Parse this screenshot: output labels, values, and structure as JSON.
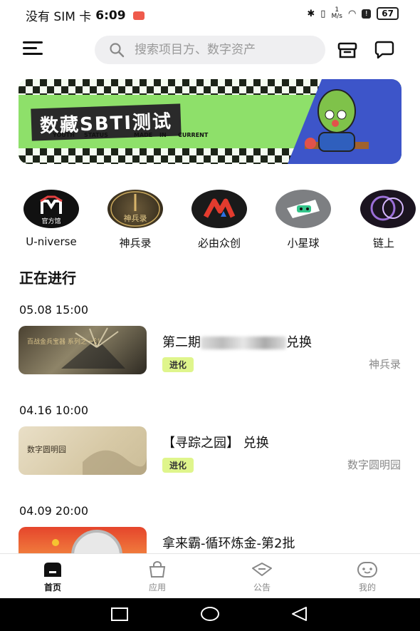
{
  "status_bar": {
    "carrier": "没有 SIM 卡",
    "time": "6:09",
    "net_speed_num": "1",
    "net_speed_unit": "M/s",
    "battery": "67"
  },
  "search": {
    "placeholder": "搜索项目方、数字资产"
  },
  "banner": {
    "title": "数藏SBTI测试",
    "sub1": "YOUTH",
    "sub2": "STATUS",
    "sub3": "MADE",
    "sub4": "IN",
    "sub5": "CURRENT"
  },
  "categories": [
    {
      "label": "U-niverse",
      "logo_text": "官方馆"
    },
    {
      "label": "神兵录",
      "logo_text": "神兵录"
    },
    {
      "label": "必由众创"
    },
    {
      "label": "小星球"
    },
    {
      "label": "链上"
    }
  ],
  "section": {
    "title": "正在进行"
  },
  "items": [
    {
      "date": "05.08 15:00",
      "title_prefix": "第二期",
      "title_suffix": "兑换",
      "tag": "进化",
      "brand": "神兵录",
      "image_text": "百战金兵宝器 系列之一剑"
    },
    {
      "date": "04.16 10:00",
      "title": "【寻踪之园】 兑换",
      "tag": "进化",
      "brand": "数字圆明园",
      "image_text": "数字圆明园"
    },
    {
      "date": "04.09 20:00",
      "title": "拿来霸-循环炼金-第2批"
    }
  ],
  "tabs": [
    {
      "label": "首页",
      "active": true
    },
    {
      "label": "应用"
    },
    {
      "label": "公告"
    },
    {
      "label": "我的"
    }
  ],
  "colors": {
    "accent": "#dff58c",
    "banner_green": "#8ee06a",
    "banner_blue": "#3d55c9"
  }
}
